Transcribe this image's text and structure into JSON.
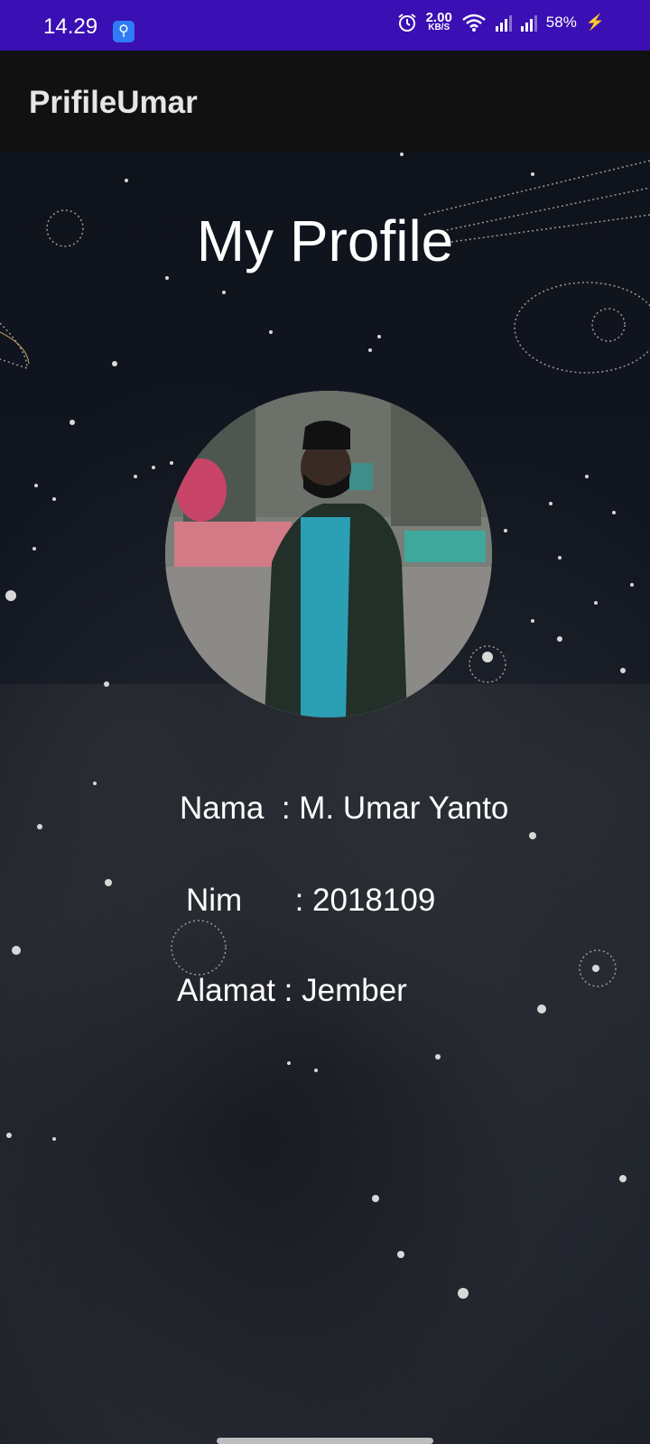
{
  "status": {
    "time": "14.29",
    "speed_top": "2.00",
    "speed_unit": "KB/S",
    "battery": "58%"
  },
  "app": {
    "title": "PrifileUmar"
  },
  "profile": {
    "heading": "My Profile",
    "name_label": "Nama",
    "name_value": ": M. Umar Yanto",
    "nim_label": "Nim",
    "nim_value": ": 2018109",
    "address_label": "Alamat",
    "address_value": ": Jember"
  },
  "icons": [
    "usb-icon",
    "alarm-icon",
    "wifi-icon",
    "signal-icon",
    "battery-charging-icon"
  ]
}
